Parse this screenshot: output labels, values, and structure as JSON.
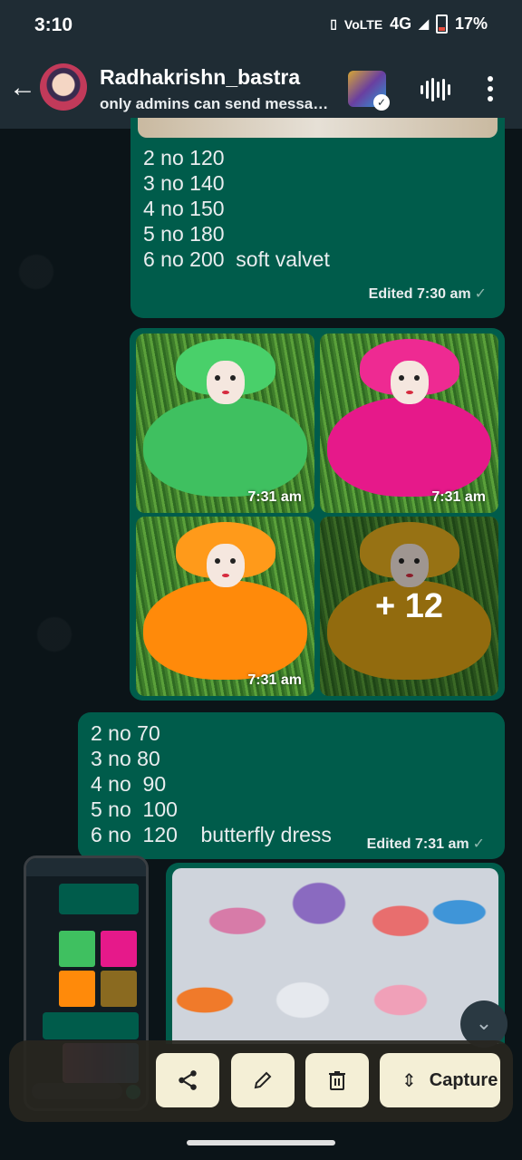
{
  "status_bar": {
    "time": "3:10",
    "network": "4G",
    "battery": "17%"
  },
  "header": {
    "title": "Radhakrishn_bastra",
    "subtitle": "only admins can send messages"
  },
  "messages": {
    "m1": {
      "text": "2 no 120\n3 no 140\n4 no 150\n5 no 180\n6 no 200  soft valvet",
      "meta": "Edited 7:30 am"
    },
    "photos": [
      {
        "time": "7:31 am",
        "dress_color": "#3fc060",
        "crown_color": "#49d06a"
      },
      {
        "time": "7:31 am",
        "dress_color": "#e6198a",
        "crown_color": "#ee2a92"
      },
      {
        "time": "7:31 am",
        "dress_color": "#ff8a0a",
        "crown_color": "#ff9a1a"
      },
      {
        "more": "+ 12",
        "dress_color": "#e0a516",
        "crown_color": "#e8b020"
      }
    ],
    "m3": {
      "text": "2 no 70\n3 no 80\n4 no  90\n5 no  100\n6 no  120    butterfly dress",
      "meta": "Edited 7:31 am"
    }
  },
  "actions": {
    "capture_label": "Capture"
  },
  "icons": [
    "back-arrow-icon",
    "voice-icon",
    "more-vert-icon",
    "share-icon",
    "edit-icon",
    "delete-icon",
    "expand-icon",
    "scroll-down-icon"
  ]
}
